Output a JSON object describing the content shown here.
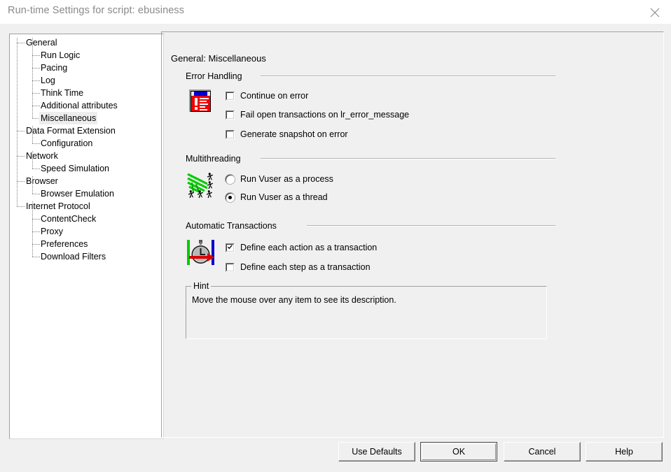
{
  "window": {
    "title": "Run-time Settings for script: ebusiness",
    "close_icon": "close-icon"
  },
  "tree": {
    "items": [
      {
        "label": "General",
        "level": 0,
        "selected": false
      },
      {
        "label": "Run Logic",
        "level": 1,
        "selected": false
      },
      {
        "label": "Pacing",
        "level": 1,
        "selected": false
      },
      {
        "label": "Log",
        "level": 1,
        "selected": false
      },
      {
        "label": "Think Time",
        "level": 1,
        "selected": false
      },
      {
        "label": "Additional attributes",
        "level": 1,
        "selected": false
      },
      {
        "label": "Miscellaneous",
        "level": 1,
        "selected": true
      },
      {
        "label": "Data Format Extension",
        "level": 0,
        "selected": false
      },
      {
        "label": "Configuration",
        "level": 1,
        "selected": false
      },
      {
        "label": "Network",
        "level": 0,
        "selected": false
      },
      {
        "label": "Speed Simulation",
        "level": 1,
        "selected": false
      },
      {
        "label": "Browser",
        "level": 0,
        "selected": false
      },
      {
        "label": "Browser Emulation",
        "level": 1,
        "selected": false
      },
      {
        "label": "Internet Protocol",
        "level": 0,
        "selected": false
      },
      {
        "label": "ContentCheck",
        "level": 1,
        "selected": false
      },
      {
        "label": "Proxy",
        "level": 1,
        "selected": false
      },
      {
        "label": "Preferences",
        "level": 1,
        "selected": false
      },
      {
        "label": "Download Filters",
        "level": 1,
        "selected": false
      }
    ]
  },
  "panel": {
    "title": "General: Miscellaneous",
    "sections": {
      "error_handling": {
        "title": "Error Handling",
        "icon": "error-document-icon",
        "options": [
          {
            "label": "Continue on error",
            "checked": false
          },
          {
            "label": "Fail open transactions on lr_error_message",
            "checked": false
          },
          {
            "label": "Generate snapshot on error",
            "checked": false
          }
        ]
      },
      "multithreading": {
        "title": "Multithreading",
        "icon": "running-threads-icon",
        "options": [
          {
            "label": "Run Vuser as a process",
            "selected": false
          },
          {
            "label": "Run Vuser as a thread",
            "selected": true
          }
        ]
      },
      "automatic_transactions": {
        "title": "Automatic Transactions",
        "icon": "stopwatch-icon",
        "options": [
          {
            "label": "Define each action as a transaction",
            "checked": true
          },
          {
            "label": "Define each step as a transaction",
            "checked": false
          }
        ]
      }
    },
    "hint": {
      "title": "Hint",
      "text": "Move the mouse over any item to see its description."
    }
  },
  "buttons": {
    "use_defaults": "Use Defaults",
    "ok": "OK",
    "cancel": "Cancel",
    "help": "Help"
  },
  "colors": {
    "dialog_bg": "#f0f0f0",
    "panel_bg": "#ffffff",
    "title_text": "#8a8a8a",
    "selection_bg": "#ededed",
    "error_icon_red": "#ee0000",
    "error_icon_blue": "#0000cc",
    "thread_icon_green": "#00cc00",
    "stopwatch_arrow_red": "#dd0000"
  }
}
